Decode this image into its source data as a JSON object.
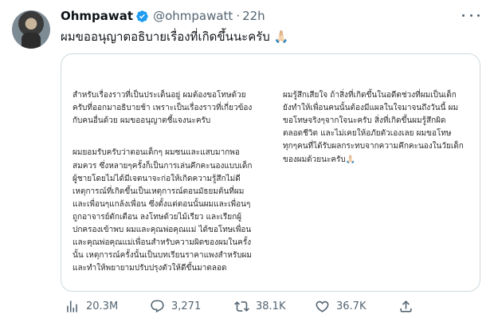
{
  "tweet": {
    "author_name": "Ohmpawat",
    "handle": "@ohmpawatt",
    "separator": "·",
    "time": "22h",
    "text": "ผมขออนุญาตอธิบายเรื่องที่เกิดขึ้นนะครับ 🙏🏻"
  },
  "image_text": {
    "left_p1": "สำหรับเรื่องราวที่เป็นประเด็นอยู่ ผมต้องขอโทษด้วย\nครับที่ออกมาอธิบายช้า เพราะเป็นเรื่องราวที่เกี่ยวข้อง\nกับคนอื่นด้วย ผมขออนุญาตชี้แจงนะครับ",
    "left_p2": "ผมยอมรับครับว่าตอนเด็กๆ ผมซนและแสบมากพอ\nสมควร ซึ่งหลายๆครั้งก็เป็นการเล่นคึกคะนองแบบเด็ก\nผู้ชายโดยไม่ได้มีเจตนาจะก่อให้เกิดความรู้สึกไม่ดี\nเหตุการณ์ที่เกิดขึ้นเป็นเหตุการณ์ตอนมัธยมต้นที่ผม\nและเพื่อนๆแกล้งเพื่อน ซึ่งตั้งแต่ตอนนั้นผมและเพื่อนๆ\nถูกอาจารย์ตักเตือน ลงโทษด้วยไม้เรียว และเรียกผู้\nปกครองเข้าพบ ผมและคุณพ่อคุณแม่ ได้ขอโทษเพื่อน\nและคุณพ่อคุณแม่เพื่อนสำหรับความผิดของผมในครั้ง\nนั้น เหตุการณ์ครั้งนั้นเป็นบทเรียนราคาแพงสำหรับผม\nและทำให้พยายามปรับปรุงตัวให้ดีขึ้นมาตลอด",
    "right_p1": "ผมรู้สึกเสียใจ ถ้าสิ่งที่เกิดขึ้นในอดีตช่วงที่ผมเป็นเด็ก\nยังทำให้เพื่อนคนนั้นต้องมีแผลในใจมาจนถึงวันนี้ ผม\nขอโทษจริงๆจากใจนะครับ สิ่งที่เกิดขึ้นผมรู้สึกผิด\nตลอดชีวิต และไม่เคยให้อภัยตัวเองเลย ผมขอโทษ\nทุกๆคนที่ได้รับผลกระทบจากความคึกคะนองในวัยเด็ก\nของผมด้วยนะครับ🙏🏻"
  },
  "actions": {
    "views": "20.3M",
    "replies": "3,271",
    "retweets": "38.1K",
    "likes": "36.7K"
  },
  "colors": {
    "verified": "#1d9bf0",
    "muted": "#536471",
    "border": "#cfd9de"
  },
  "icons": [
    "verified-badge-icon",
    "more-options-icon",
    "views-icon",
    "reply-icon",
    "retweet-icon",
    "like-icon",
    "share-icon"
  ]
}
